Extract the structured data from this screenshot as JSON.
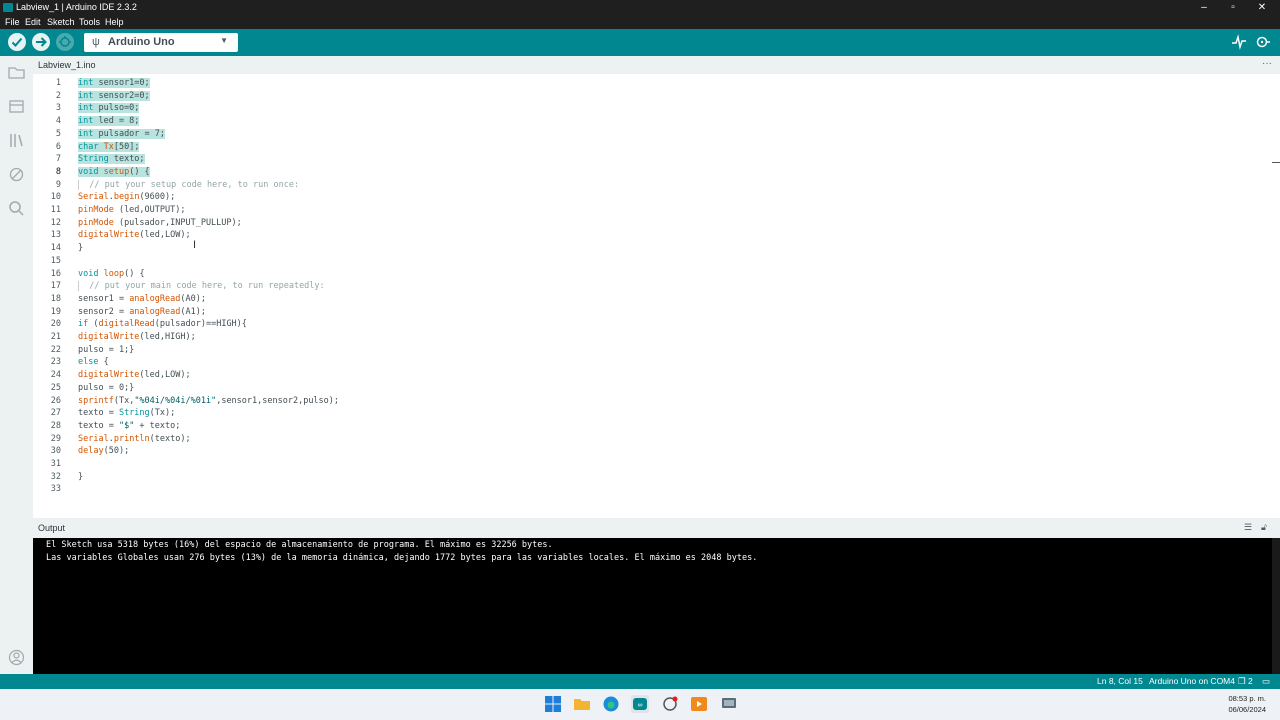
{
  "window": {
    "title": "Labview_1 | Arduino IDE 2.3.2"
  },
  "menu": [
    "File",
    "Edit",
    "Sketch",
    "Tools",
    "Help"
  ],
  "toolbar": {
    "board": "Arduino Uno"
  },
  "tab": {
    "filename": "Labview_1.ino",
    "more": "···"
  },
  "editor": {
    "lines": [
      "int sensor1=0;",
      "int sensor2=0;",
      "int pulso=0;",
      "int led = 8;",
      "int pulsador = 7;",
      "char Tx[50];",
      "String texto;",
      "void setup() {",
      "  // put your setup code here, to run once:",
      "Serial.begin(9600);",
      "pinMode (led,OUTPUT);",
      "pinMode (pulsador,INPUT_PULLUP);",
      "digitalWrite(led,LOW);",
      "}",
      "",
      "void loop() {",
      "  // put your main code here, to run repeatedly:",
      "sensor1 = analogRead(A0);",
      "sensor2 = analogRead(A1);",
      "if (digitalRead(pulsador)==HIGH){",
      "digitalWrite(led,HIGH);",
      "pulso = 1;}",
      "else {",
      "digitalWrite(led,LOW);",
      "pulso = 0;}",
      "sprintf(Tx,\"%04i/%04i/%01i\",sensor1,sensor2,pulso);",
      "texto = String(Tx);",
      "texto = \"$\" + texto;",
      "Serial.println(texto);",
      "delay(50);",
      "",
      "}",
      ""
    ],
    "selected_lines": 8
  },
  "output": {
    "label": "Output",
    "lines": [
      "El Sketch usa 5318 bytes (16%) del espacio de almacenamiento de programa. El máximo es 32256 bytes.",
      "Las variables Globales usan 276 bytes (13%) de la memoria dinámica, dejando 1772 bytes para las variables locales. El máximo es 2048 bytes."
    ]
  },
  "status": {
    "position": "Ln 8, Col 15",
    "board": "Arduino Uno on COM4",
    "notifications": "2"
  },
  "clock": {
    "time": "08:53 p. m.",
    "date": "06/06/2024"
  },
  "colors": {
    "accent": "#00878f",
    "keyword": "#00979c",
    "function": "#d35400",
    "comment": "#95a5a6",
    "selection": "#b9e3df"
  }
}
